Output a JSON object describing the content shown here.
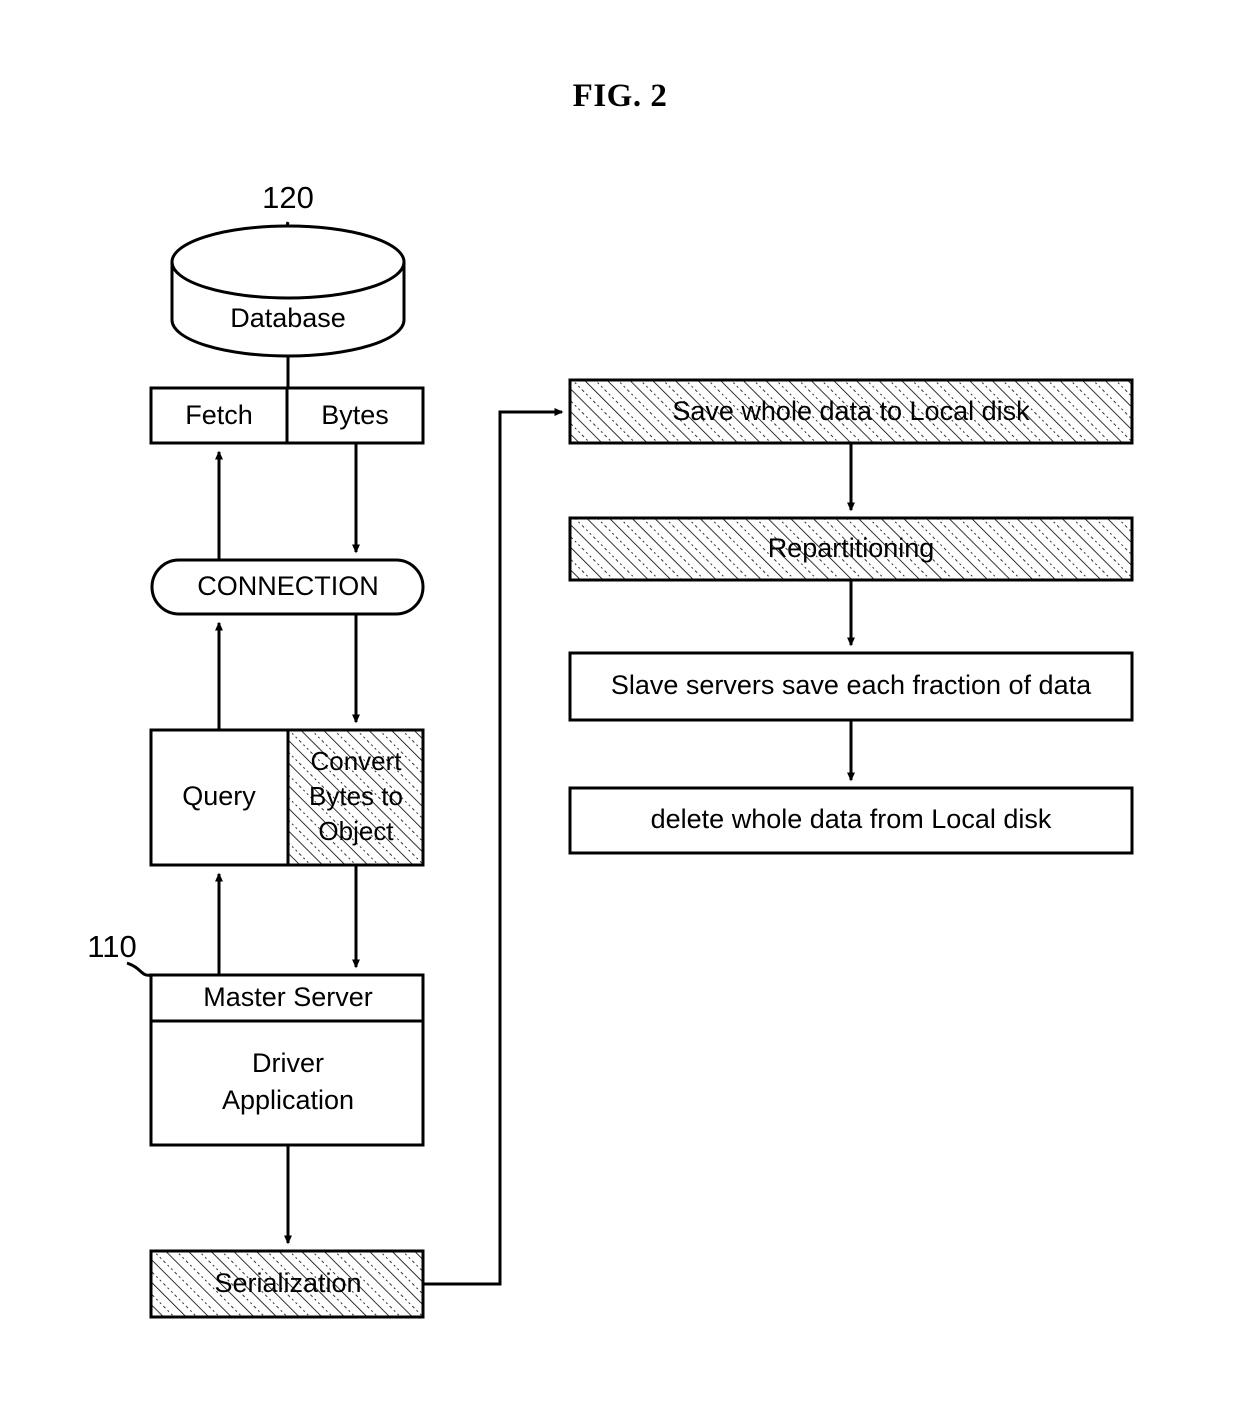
{
  "figure": {
    "title": "FIG. 2"
  },
  "reference_numerals": [
    {
      "id": "ref-120",
      "label": "120",
      "points_to": "Database"
    },
    {
      "id": "ref-110",
      "label": "110",
      "points_to": "Master Server"
    }
  ],
  "left_column": {
    "database": {
      "label": "Database",
      "shape": "cylinder",
      "hatched": false
    },
    "fetch_bytes": {
      "shape": "split-box",
      "cells": [
        {
          "label": "Fetch",
          "hatched": false
        },
        {
          "label": "Bytes",
          "hatched": false
        }
      ]
    },
    "connection": {
      "label": "CONNECTION",
      "shape": "stadium",
      "hatched": false
    },
    "query_convert": {
      "shape": "split-box",
      "cells": [
        {
          "label": "Query",
          "hatched": false
        },
        {
          "label": "Convert Bytes to Object",
          "lines": [
            "Convert",
            "Bytes to",
            "Object"
          ],
          "hatched": true
        }
      ]
    },
    "master_server": {
      "shape": "header-box",
      "header": "Master Server",
      "body_lines": [
        "Driver",
        "Application"
      ],
      "hatched": false
    },
    "serialization": {
      "label": "Serialization",
      "shape": "box",
      "hatched": true
    }
  },
  "right_column": {
    "steps": [
      {
        "label": "Save whole data to Local disk",
        "hatched": true
      },
      {
        "label": "Repartitioning",
        "hatched": true
      },
      {
        "label": "Slave servers save each fraction of data",
        "hatched": false
      },
      {
        "label": "delete whole data from Local disk",
        "hatched": false
      }
    ]
  },
  "colors": {
    "stroke": "#000000",
    "fill": "#ffffff",
    "background": "#ffffff"
  }
}
